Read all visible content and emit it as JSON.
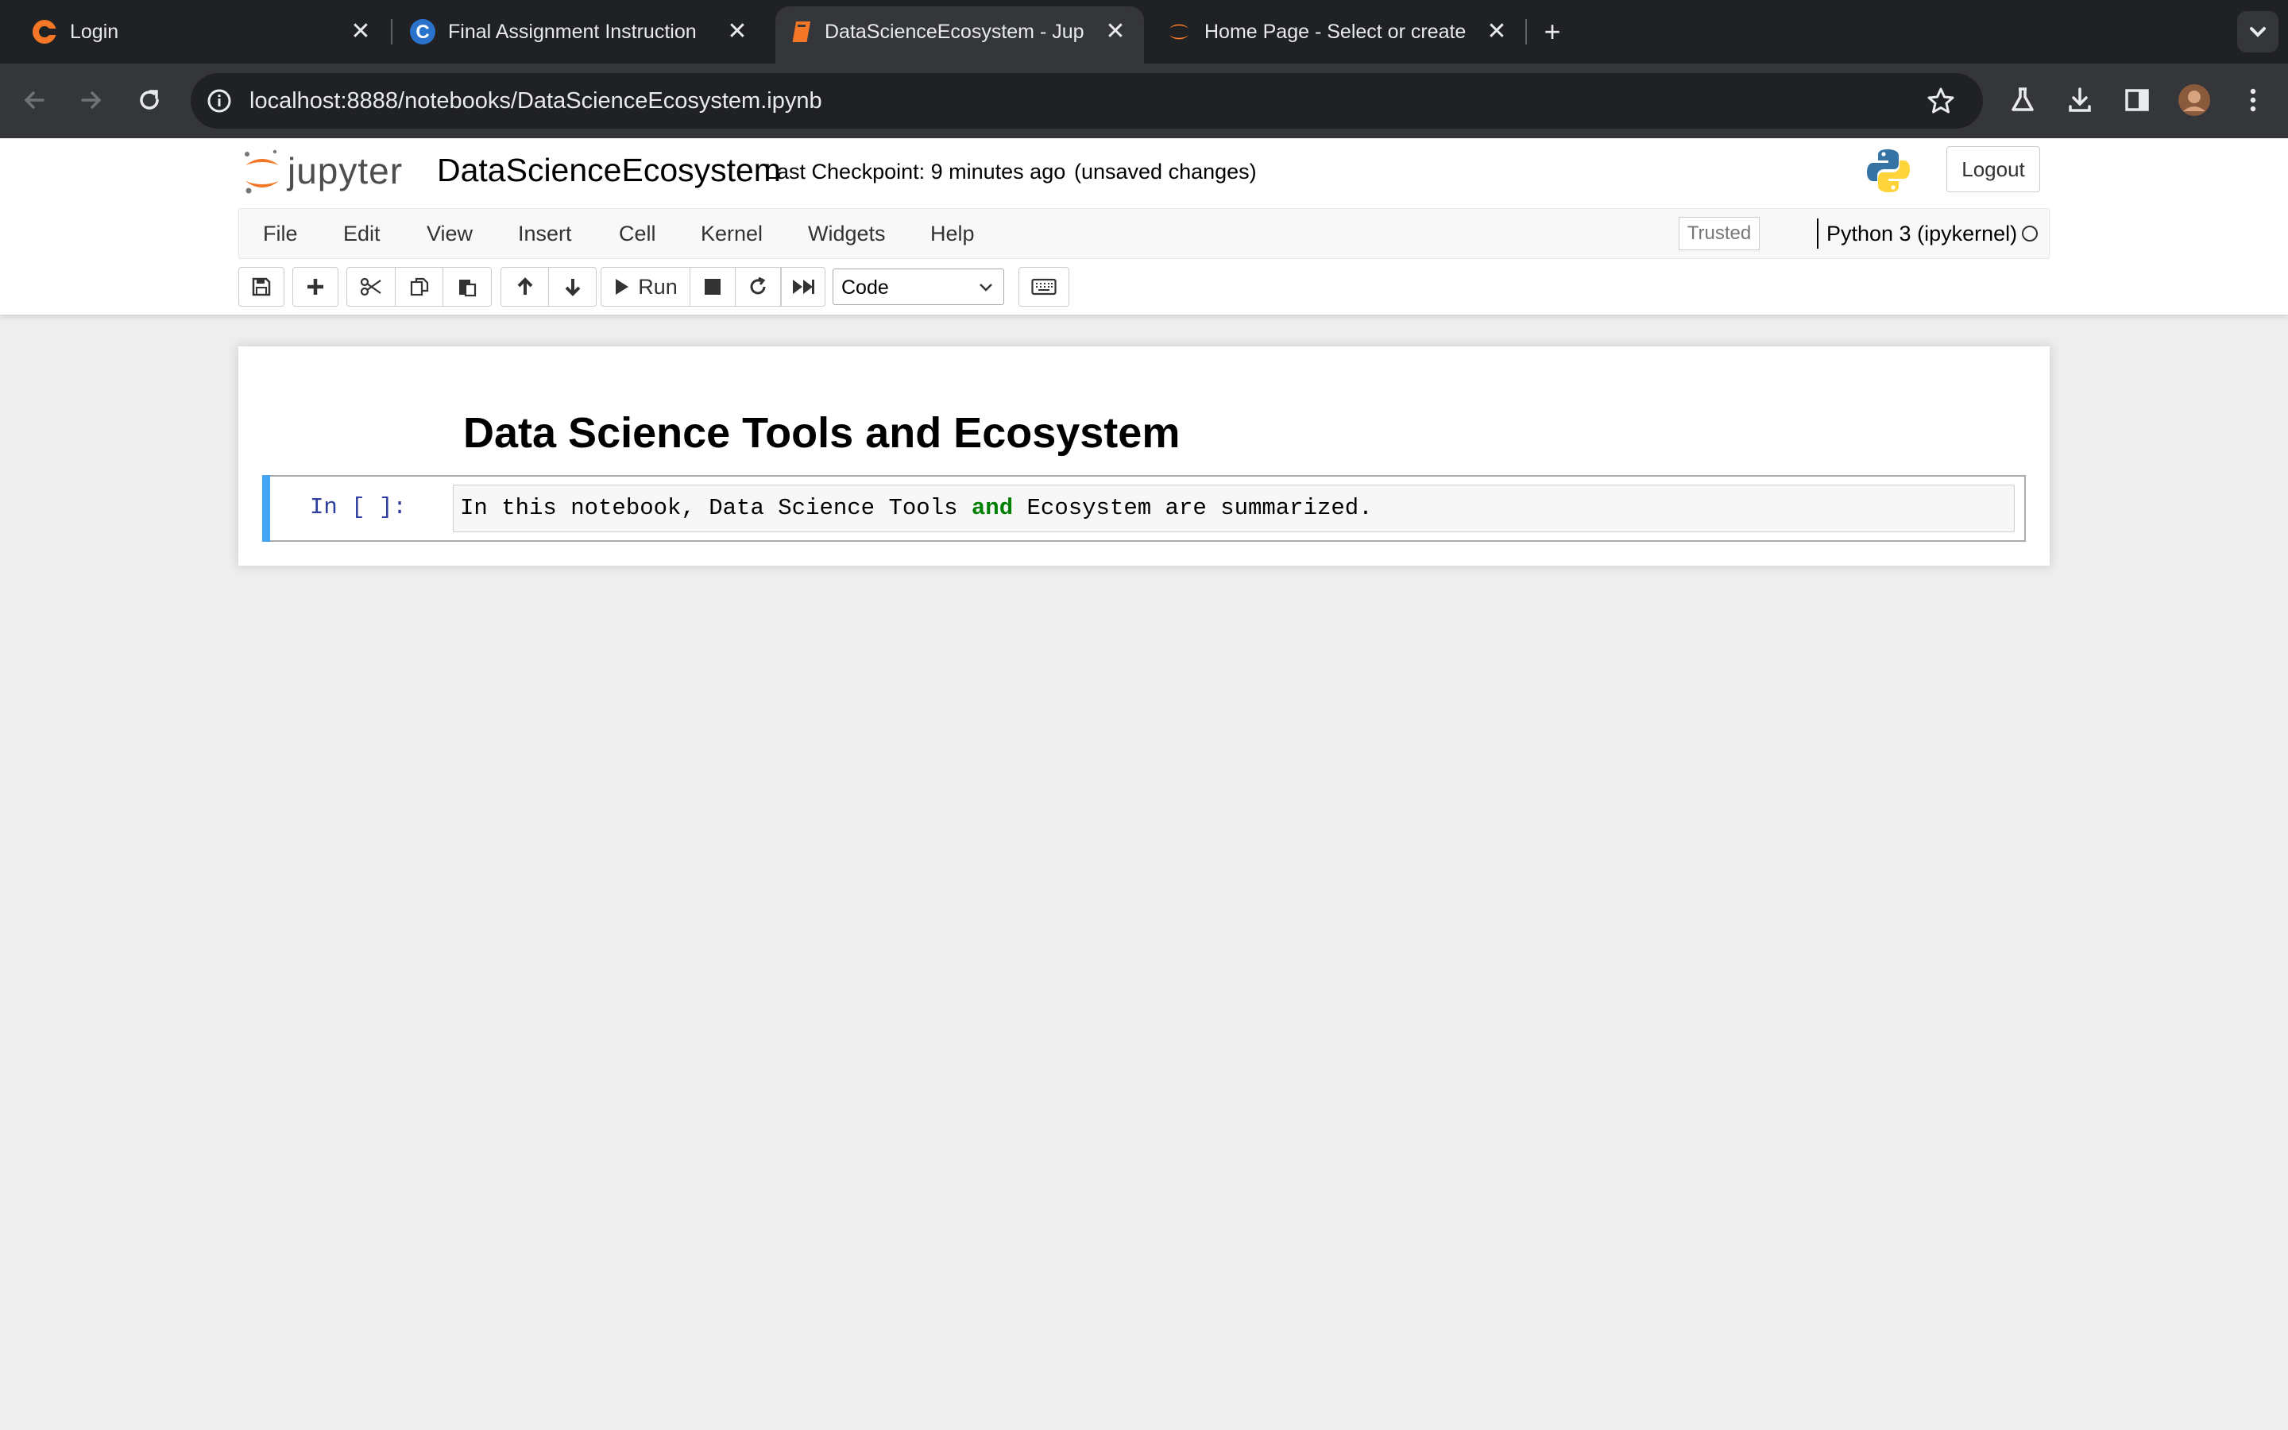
{
  "browser": {
    "tabs": [
      {
        "title": "Login",
        "favicon": "coursera-login-icon",
        "active": false
      },
      {
        "title": "Final Assignment Instruction",
        "favicon": "coursera-icon",
        "active": false
      },
      {
        "title": "DataScienceEcosystem - Jup",
        "favicon": "notebook-icon",
        "active": true
      },
      {
        "title": "Home Page - Select or create",
        "favicon": "jupyter-icon",
        "active": false
      }
    ],
    "new_tab_label": "+",
    "url": "localhost:8888/notebooks/DataScienceEcosystem.ipynb"
  },
  "jupyter": {
    "logo_text": "jupyter",
    "notebook_name": "DataScienceEcosystem",
    "checkpoint": "Last Checkpoint: 9 minutes ago",
    "unsaved": "(unsaved changes)",
    "logout_label": "Logout",
    "menu": [
      "File",
      "Edit",
      "View",
      "Insert",
      "Cell",
      "Kernel",
      "Widgets",
      "Help"
    ],
    "trusted_label": "Trusted",
    "kernel_name": "Python 3 (ipykernel)",
    "run_label": "Run",
    "cell_type": "Code"
  },
  "notebook": {
    "heading": "Data Science Tools and Ecosystem",
    "cell_prompt": "In [ ]:",
    "cell_code_before": "In this notebook, Data Science Tools ",
    "cell_code_keyword": "and",
    "cell_code_after": " Ecosystem are summarized."
  },
  "colors": {
    "cell_stripe": "#42a5f5",
    "prompt": "#303f9f",
    "keyword": "#008000",
    "jupyter_orange": "#f37726"
  }
}
